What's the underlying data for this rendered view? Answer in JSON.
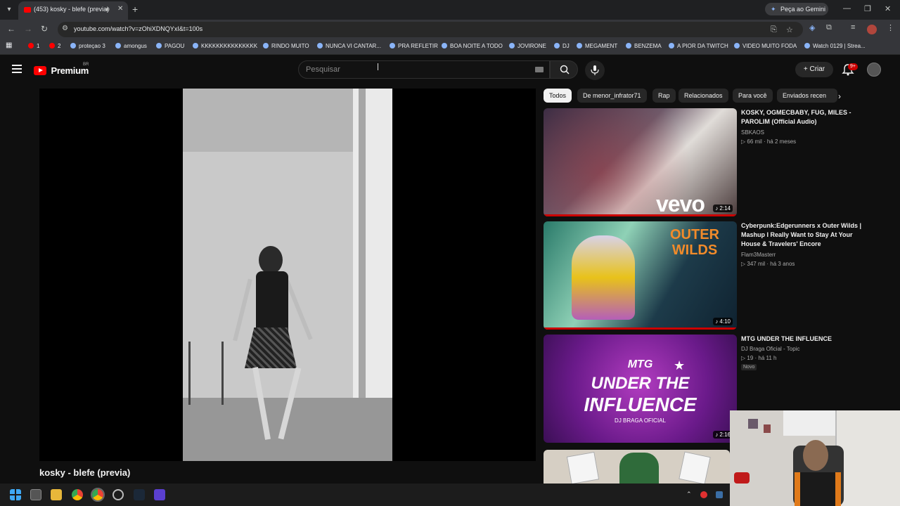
{
  "browser": {
    "tab_title": "(453) kosky - blefe (previa)",
    "gemini_label": "Peça ao Gemini",
    "url": "youtube.com/watch?v=zOhiXDNQYxI&t=100s"
  },
  "bookmarks": [
    {
      "label": "1",
      "color": "red"
    },
    {
      "label": "2",
      "color": "red"
    },
    {
      "label": "proteçao 3"
    },
    {
      "label": "amongus"
    },
    {
      "label": "PAGOU"
    },
    {
      "label": "KKKKKKKKKKKKKKK"
    },
    {
      "label": "RINDO MUITO"
    },
    {
      "label": "NUNCA VI CANTAR..."
    },
    {
      "label": "PRA REFLETIR"
    },
    {
      "label": "BOA NOITE A TODO"
    },
    {
      "label": "JOVIRONE"
    },
    {
      "label": "DJ"
    },
    {
      "label": "MEGAMENT"
    },
    {
      "label": "BENZEMA"
    },
    {
      "label": "A PIOR DA TWITCH"
    },
    {
      "label": "VIDEO MUITO FODA"
    },
    {
      "label": "Watch 0129 | Strea..."
    }
  ],
  "header": {
    "logo_text": "Premium",
    "region": "BR",
    "search_placeholder": "Pesquisar",
    "create_label": "Criar",
    "notif_count": "9+"
  },
  "video": {
    "title": "kosky - blefe (previa)"
  },
  "chips": [
    "Todos",
    "De menor_infrator71",
    "Rap",
    "Relacionados",
    "Para você",
    "Enviados recen"
  ],
  "recommendations": [
    {
      "title": "KOSKY, OGMECBABY, FUG, MILES - PAROLIM (Official Audio)",
      "channel": "SBKAOS",
      "views": "66 mil",
      "age": "há 2 meses",
      "duration": "2:14",
      "thumb_text": "vevo"
    },
    {
      "title": "Cyberpunk:Edgerunners x Outer Wilds | Mashup I Really Want to Stay At Your House & Travelers' Encore",
      "channel": "Flam3Masterr",
      "views": "347 mil",
      "age": "há 3 anos",
      "duration": "4:10",
      "thumb_text": "OUTER WILDS"
    },
    {
      "title": "MTG UNDER THE INFLUENCE",
      "channel": "DJ Braga Oficial - Topic",
      "views": "19",
      "age": "há 11 h",
      "badge": "Novo",
      "duration": "2:16",
      "thumb_text_1": "MTG",
      "thumb_text_2": "UNDER THE",
      "thumb_text_3": "INFLUENCE",
      "thumb_text_4": "DJ BRAGA OFICIAL"
    }
  ],
  "colors": {
    "yt_red": "#ff0000",
    "background": "#0f0f0f",
    "chip_active": "#f1f1f1"
  }
}
